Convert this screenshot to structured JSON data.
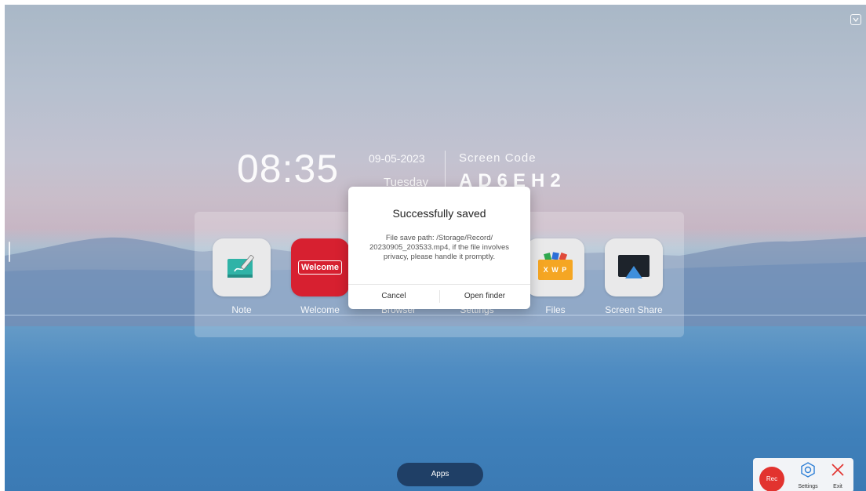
{
  "status": {
    "time": "08:35",
    "date": "09-05-2023",
    "weekday": "Tuesday"
  },
  "screen_code": {
    "label": "Screen Code",
    "value": "AD6EH2"
  },
  "apps": [
    {
      "label": "Note",
      "icon": "note-pen-icon"
    },
    {
      "label": "Welcome",
      "icon": "welcome-icon",
      "icon_text": "Welcome"
    },
    {
      "label": "Browser",
      "icon": "browser-icon"
    },
    {
      "label": "Settings",
      "icon": "settings-icon"
    },
    {
      "label": "Files",
      "icon": "files-icon",
      "icon_text": "X W P"
    },
    {
      "label": "Screen Share",
      "icon": "screen-share-icon"
    }
  ],
  "dialog": {
    "title": "Successfully saved",
    "body": "File save path: /Storage/Record/ 20230905_203533.mp4, if the file involves privacy, please handle it promptly.",
    "cancel_label": "Cancel",
    "confirm_label": "Open finder"
  },
  "bottom": {
    "apps_label": "Apps"
  },
  "toolbar": {
    "rec_label": "Rec",
    "settings_label": "Settings",
    "exit_label": "Exit"
  },
  "colors": {
    "accent_dark": "#1f3f66",
    "rec": "#e2332f",
    "welcome": "#d72030",
    "files_bg": "#f5a623"
  }
}
